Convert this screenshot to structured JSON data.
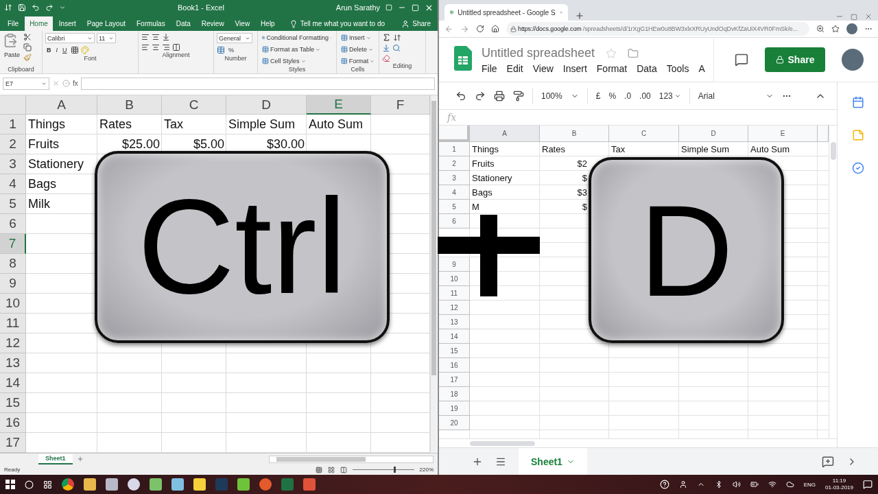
{
  "excel": {
    "title": "Book1  -  Excel",
    "user": "Arun Sarathy",
    "ribbon_tabs": [
      {
        "label": "File",
        "selected": false
      },
      {
        "label": "Home",
        "selected": true
      },
      {
        "label": "Insert",
        "selected": false
      },
      {
        "label": "Page Layout",
        "selected": false
      },
      {
        "label": "Formulas",
        "selected": false
      },
      {
        "label": "Data",
        "selected": false
      },
      {
        "label": "Review",
        "selected": false
      },
      {
        "label": "View",
        "selected": false
      },
      {
        "label": "Help",
        "selected": false
      }
    ],
    "tell_me": "Tell me what you want to do",
    "share": "Share",
    "ribbon_groups": [
      {
        "label": "Clipboard",
        "kind": "clipboard",
        "items": [
          "Paste"
        ]
      },
      {
        "label": "Font",
        "kind": "font",
        "items": [
          "Calibri",
          "11",
          "B",
          "I",
          "U"
        ]
      },
      {
        "label": "Alignment",
        "kind": "alignment"
      },
      {
        "label": "Number",
        "kind": "number",
        "items": [
          "General",
          "%"
        ]
      },
      {
        "label": "Styles",
        "kind": "styles",
        "items": [
          "Conditional Formatting",
          "Format as Table",
          "Cell Styles"
        ]
      },
      {
        "label": "Cells",
        "kind": "cells",
        "items": [
          "Insert",
          "Delete",
          "Format"
        ]
      },
      {
        "label": "Editing",
        "kind": "editing"
      }
    ],
    "name_box": "E7",
    "fx": "fx",
    "columns": [
      {
        "label": "A",
        "selected": false
      },
      {
        "label": "B",
        "selected": false
      },
      {
        "label": "C",
        "selected": false
      },
      {
        "label": "D",
        "selected": false
      },
      {
        "label": "E",
        "selected": true
      },
      {
        "label": "F",
        "selected": false
      }
    ],
    "rows": [
      {
        "label": "1",
        "selected": false,
        "cells": [
          {
            "text": "Things",
            "kind": "text"
          },
          {
            "text": "Rates",
            "kind": "text"
          },
          {
            "text": "Tax",
            "kind": "text"
          },
          {
            "text": "Simple Sum",
            "kind": "text"
          },
          {
            "text": "Auto Sum",
            "kind": "text"
          }
        ]
      },
      {
        "label": "2",
        "selected": false,
        "cells": [
          {
            "text": "Fruits",
            "kind": "text"
          },
          {
            "text": "$25.00",
            "kind": "number"
          },
          {
            "text": "$5.00",
            "kind": "number"
          },
          {
            "text": "$30.00",
            "kind": "number"
          }
        ]
      },
      {
        "label": "3",
        "selected": false,
        "cells": [
          {
            "text": "Stationery",
            "kind": "text"
          }
        ]
      },
      {
        "label": "4",
        "selected": false,
        "cells": [
          {
            "text": "Bags",
            "kind": "text"
          }
        ]
      },
      {
        "label": "5",
        "selected": false,
        "cells": [
          {
            "text": "Milk",
            "kind": "text"
          }
        ]
      },
      {
        "label": "6",
        "selected": false
      },
      {
        "label": "7",
        "selected": true
      },
      {
        "label": "8",
        "selected": false
      },
      {
        "label": "9",
        "selected": false
      },
      {
        "label": "10",
        "selected": false
      },
      {
        "label": "11",
        "selected": false
      },
      {
        "label": "12",
        "selected": false
      },
      {
        "label": "13",
        "selected": false
      },
      {
        "label": "14",
        "selected": false
      },
      {
        "label": "15",
        "selected": false
      },
      {
        "label": "16",
        "selected": false
      },
      {
        "label": "17",
        "selected": false
      }
    ],
    "sheet_tab": "Sheet1",
    "status": "Ready",
    "zoom_slider": {
      "level": 0.7
    },
    "zoom": "220%"
  },
  "sheets": {
    "browser_tab": "Untitled spreadsheet - Google S",
    "url_host": "https://docs.google.com",
    "url_path": "/spreadsheets/d/1rXgG1HEw0u8BW3xlxXRUyUndOqDvKfZaUiX4VR0FmSk/e...",
    "doc_title": "Untitled spreadsheet",
    "menu": [
      "File",
      "Edit",
      "View",
      "Insert",
      "Format",
      "Data",
      "Tools",
      "A"
    ],
    "share": "Share",
    "toolbar": {
      "zoom": "100%",
      "currency": "£",
      "percent": "%",
      "decrease_decimals": ".0",
      "increase_decimals": ".00",
      "format": "123",
      "font": "Arial"
    },
    "fx": "fx",
    "columns": [
      {
        "label": "A",
        "selected": true
      },
      {
        "label": "B",
        "selected": false
      },
      {
        "label": "C",
        "selected": false
      },
      {
        "label": "D",
        "selected": false
      },
      {
        "label": "E",
        "selected": false
      }
    ],
    "rows": [
      {
        "label": "1",
        "cells": [
          {
            "text": "Things",
            "kind": "text"
          },
          {
            "text": "Rates",
            "kind": "text"
          },
          {
            "text": "Tax",
            "kind": "text"
          },
          {
            "text": "Simple Sum",
            "kind": "text"
          },
          {
            "text": "Auto Sum",
            "kind": "text"
          }
        ]
      },
      {
        "label": "2",
        "cells": [
          {
            "text": "Fruits",
            "kind": "text"
          },
          {
            "text": "$2",
            "kind": "number"
          }
        ]
      },
      {
        "label": "3",
        "cells": [
          {
            "text": "Stationery",
            "kind": "text"
          },
          {
            "text": "$",
            "kind": "number"
          }
        ]
      },
      {
        "label": "4",
        "cells": [
          {
            "text": "Bags",
            "kind": "text"
          },
          {
            "text": "$3",
            "kind": "number"
          }
        ]
      },
      {
        "label": "5",
        "cells": [
          {
            "text": "M",
            "kind": "text"
          },
          {
            "text": "$",
            "kind": "number"
          }
        ]
      },
      {
        "label": "6"
      },
      {},
      {},
      {
        "label": "9"
      },
      {
        "label": "10"
      },
      {
        "label": "11"
      },
      {
        "label": "12"
      },
      {
        "label": "13"
      },
      {
        "label": "14"
      },
      {
        "label": "15"
      },
      {
        "label": "16"
      },
      {
        "label": "17"
      },
      {
        "label": "18"
      },
      {
        "label": "19"
      },
      {
        "label": "20"
      }
    ],
    "sheet_tab": "Sheet1"
  },
  "overlay": {
    "keys": [
      "Ctrl",
      "D"
    ]
  },
  "taskbar": {
    "language": "ENG",
    "time": "11:19",
    "date": "01-03-2019"
  }
}
